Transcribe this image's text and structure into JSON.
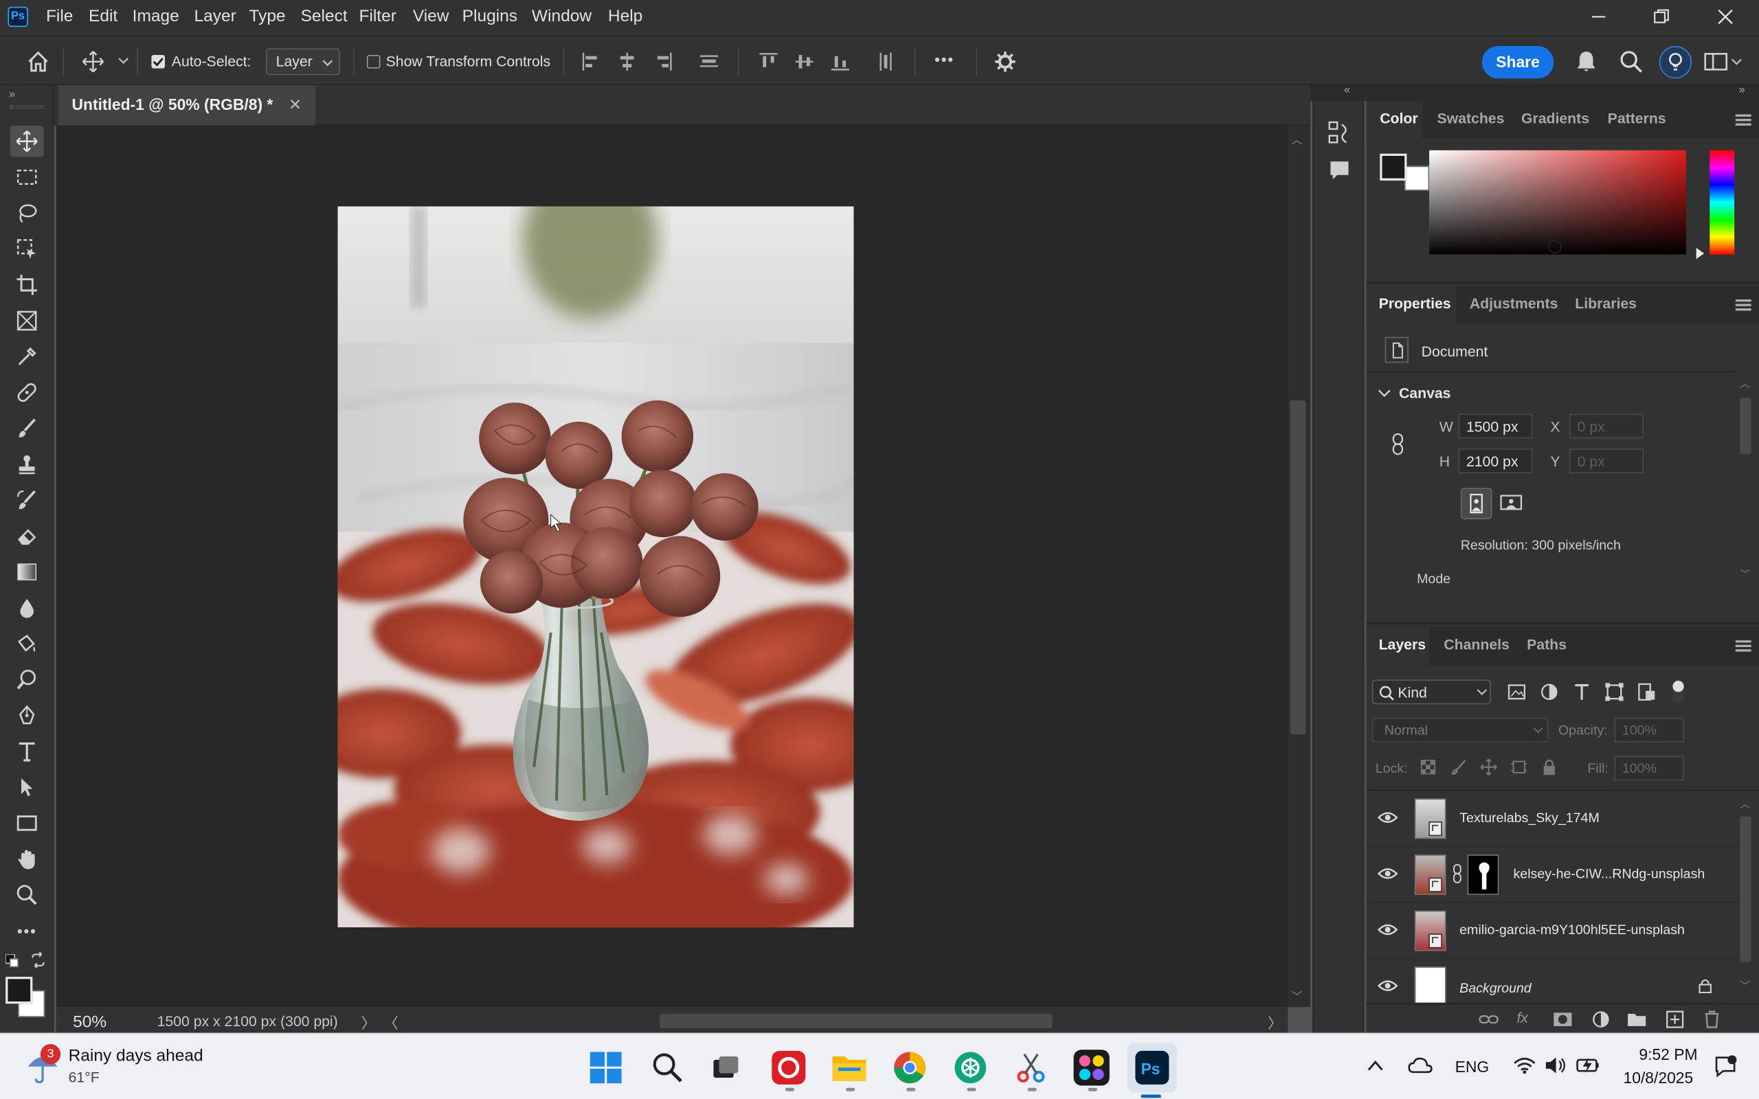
{
  "app": {
    "logo": "Ps"
  },
  "menu": [
    "File",
    "Edit",
    "Image",
    "Layer",
    "Type",
    "Select",
    "Filter",
    "View",
    "Plugins",
    "Window",
    "Help"
  ],
  "options": {
    "auto_select_label": "Auto-Select:",
    "auto_select_checked": true,
    "auto_select_target": "Layer",
    "show_transform_label": "Show Transform Controls",
    "show_transform_checked": false,
    "more": "•••",
    "share_label": "Share"
  },
  "document": {
    "tab_title": "Untitled-1 @ 50% (RGB/8) *",
    "zoom": "50%",
    "dimensions": "1500 px x 2100 px (300 ppi)"
  },
  "color_panel": {
    "tabs": [
      "Color",
      "Swatches",
      "Gradients",
      "Patterns"
    ],
    "active_tab": "Color",
    "foreground": "#1a1a1a",
    "background": "#ffffff",
    "hue_color": "#e01b1b"
  },
  "properties_panel": {
    "tabs": [
      "Properties",
      "Adjustments",
      "Libraries"
    ],
    "active_tab": "Properties",
    "type_label": "Document",
    "section": "Canvas",
    "w_label": "W",
    "w_value": "1500 px",
    "h_label": "H",
    "h_value": "2100 px",
    "x_label": "X",
    "x_placeholder": "0 px",
    "y_label": "Y",
    "y_placeholder": "0 px",
    "resolution": "Resolution: 300 pixels/inch",
    "mode_label": "Mode"
  },
  "layers_panel": {
    "tabs": [
      "Layers",
      "Channels",
      "Paths"
    ],
    "active_tab": "Layers",
    "filter_kind": "Kind",
    "blend_mode": "Normal",
    "opacity_label": "Opacity:",
    "opacity_value": "100%",
    "lock_label": "Lock:",
    "fill_label": "Fill:",
    "fill_value": "100%",
    "layers": [
      {
        "name": "Texturelabs_Sky_174M",
        "visible": true
      },
      {
        "name": "kelsey-he-CIW...RNdg-unsplash",
        "visible": true,
        "has_mask": true
      },
      {
        "name": "emilio-garcia-m9Y100hl5EE-unsplash",
        "visible": true
      },
      {
        "name": "Background",
        "visible": true,
        "locked": true
      }
    ]
  },
  "taskbar": {
    "weather_badge": "3",
    "weather_title": "Rainy days ahead",
    "weather_temp": "61°F",
    "language": "ENG",
    "time": "9:52 PM",
    "date": "10/8/2025"
  }
}
